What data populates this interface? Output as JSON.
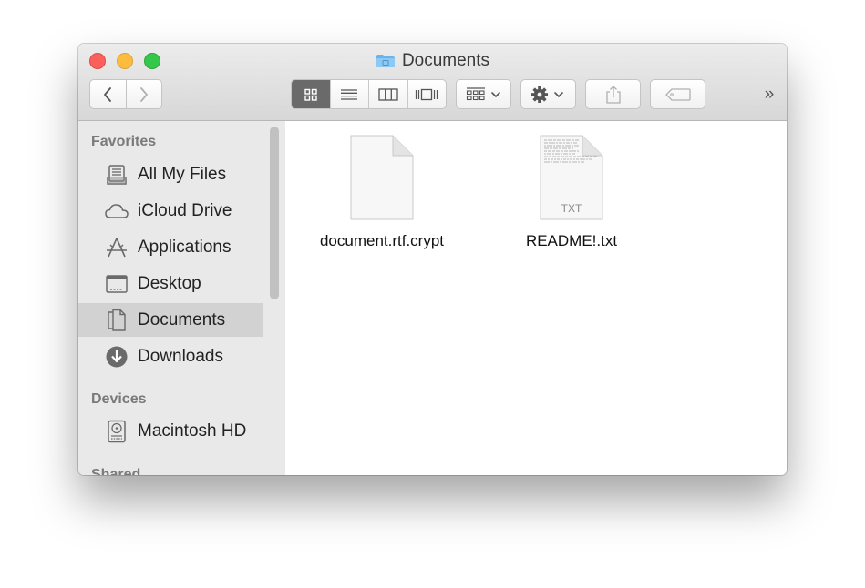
{
  "window": {
    "title": "Documents"
  },
  "toolbar": {
    "back_label": "Back",
    "forward_label": "Forward",
    "overflow_label": "»"
  },
  "sidebar": {
    "sections": [
      {
        "header": "Favorites",
        "items": [
          {
            "label": "All My Files",
            "icon": "all-files-icon"
          },
          {
            "label": "iCloud Drive",
            "icon": "cloud-icon"
          },
          {
            "label": "Applications",
            "icon": "applications-icon"
          },
          {
            "label": "Desktop",
            "icon": "desktop-icon"
          },
          {
            "label": "Documents",
            "icon": "documents-icon",
            "selected": true
          },
          {
            "label": "Downloads",
            "icon": "downloads-icon"
          }
        ]
      },
      {
        "header": "Devices",
        "items": [
          {
            "label": "Macintosh HD",
            "icon": "hard-drive-icon"
          }
        ]
      },
      {
        "header": "Shared",
        "items": []
      }
    ]
  },
  "files": [
    {
      "name": "document.rtf.crypt",
      "icon": "blank-document-icon"
    },
    {
      "name": "README!.txt",
      "icon": "text-document-icon",
      "badge": "TXT"
    }
  ],
  "colors": {
    "close": "#fc605c",
    "minimize": "#fdbc40",
    "maximize": "#34c84a",
    "sidebar_bg": "#e9e9e9",
    "selected_bg": "#d2d2d2"
  }
}
